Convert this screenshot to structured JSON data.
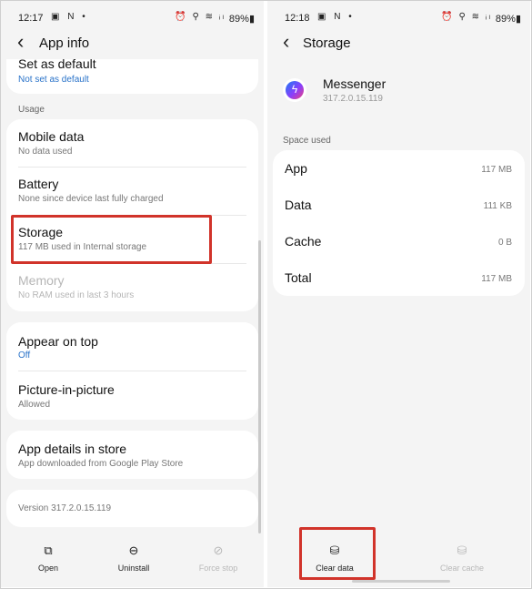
{
  "left": {
    "status": {
      "time": "12:17",
      "notif_icons": "▣ N •",
      "right_icons": "⏰ ⚲ ≋ ᵢₗ",
      "battery": "89%▮"
    },
    "appbar": {
      "back": "‹",
      "title": "App info"
    },
    "set_default": {
      "title": "Set as default",
      "sub": "Not set as default"
    },
    "usage_label": "Usage",
    "usage_rows": [
      {
        "title": "Mobile data",
        "sub": "No data used"
      },
      {
        "title": "Battery",
        "sub": "None since device last fully charged"
      },
      {
        "title": "Storage",
        "sub": "117 MB used in Internal storage"
      },
      {
        "title": "Memory",
        "sub": "No RAM used in last 3 hours"
      }
    ],
    "perm_rows": [
      {
        "title": "Appear on top",
        "sub": "Off"
      },
      {
        "title": "Picture-in-picture",
        "sub": "Allowed"
      }
    ],
    "store": {
      "title": "App details in store",
      "sub": "App downloaded from Google Play Store"
    },
    "version": "Version 317.2.0.15.119",
    "bottom_nav": [
      {
        "label": "Open",
        "icon": "⧉"
      },
      {
        "label": "Uninstall",
        "icon": "⊖"
      },
      {
        "label": "Force stop",
        "icon": "⊘"
      }
    ]
  },
  "right": {
    "status": {
      "time": "12:18",
      "notif_icons": "▣ N •",
      "right_icons": "⏰ ⚲ ≋ ᵢₗ",
      "battery": "89%▮"
    },
    "appbar": {
      "back": "‹",
      "title": "Storage"
    },
    "app": {
      "name": "Messenger",
      "version": "317.2.0.15.119",
      "icon_glyph": "ϟ"
    },
    "space_label": "Space used",
    "space_rows": [
      {
        "key": "App",
        "value": "117 MB"
      },
      {
        "key": "Data",
        "value": "111 KB"
      },
      {
        "key": "Cache",
        "value": "0 B"
      },
      {
        "key": "Total",
        "value": "117 MB"
      }
    ],
    "bottom_nav": [
      {
        "label": "Clear data",
        "icon": "⛁"
      },
      {
        "label": "Clear cache",
        "icon": "⛁"
      }
    ]
  },
  "colors": {
    "highlight": "#d1332a",
    "link_blue": "#2a73c9",
    "background": "#f4f4f4"
  }
}
